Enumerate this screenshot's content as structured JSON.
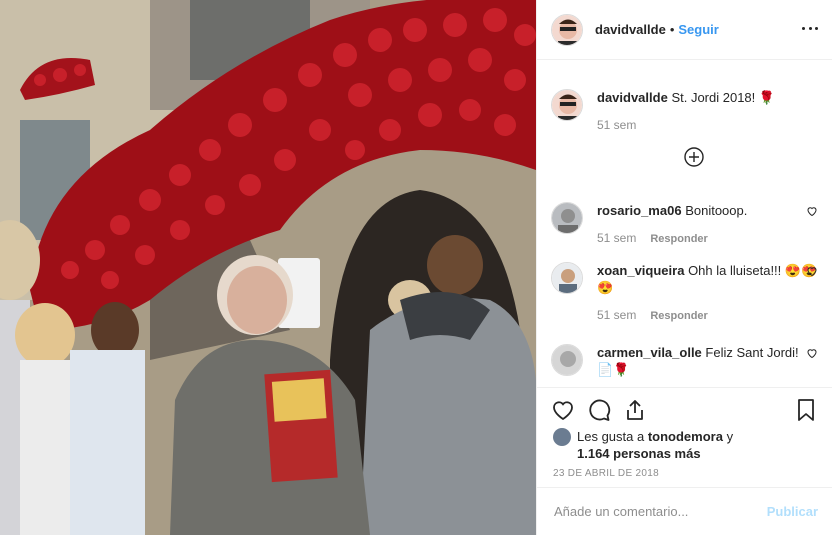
{
  "photo": {
    "alt_colors": {
      "roses": "#b3121c",
      "stone": "#8f8573"
    }
  },
  "header": {
    "username": "davidvallde",
    "separator": "•",
    "follow_label": "Seguir",
    "more_icon": "more-horizontal-icon"
  },
  "caption": {
    "username": "davidvallde",
    "text": "St. Jordi 2018! 🌹",
    "time": "51 sem"
  },
  "load_more_icon": "plus-circle-icon",
  "comments": [
    {
      "username": "rosario_ma06",
      "text": "Bonitooop.",
      "time": "51 sem",
      "reply": "Responder"
    },
    {
      "username": "xoan_viqueira",
      "text": "Ohh la lluiseta!!! 😍😍😍",
      "time": "51 sem",
      "reply": "Responder"
    },
    {
      "username": "carmen_vila_olle",
      "text": "Feliz Sant Jordi! 📄🌹",
      "time": "",
      "reply": ""
    }
  ],
  "likes": {
    "prefix": "Les gusta a ",
    "user": "tonodemora",
    "mid": " y",
    "count": "1.164 personas más"
  },
  "date": "23 DE ABRIL DE 2018",
  "add_comment": {
    "placeholder": "Añade un comentario...",
    "publish_label": "Publicar"
  },
  "colors": {
    "accent": "#3897f0",
    "publish_disabled": "#b2dffc",
    "muted": "#8e8e8e"
  }
}
